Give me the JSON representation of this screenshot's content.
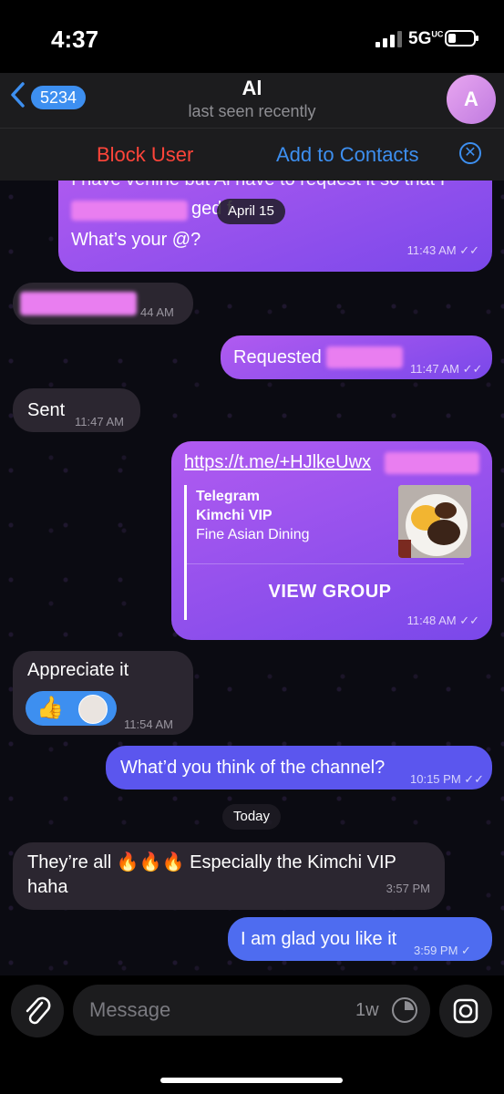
{
  "status_bar": {
    "time": "4:37",
    "network": "5G",
    "network_sup": "UC"
  },
  "header": {
    "back_count": "5234",
    "title": "Al",
    "subtitle": "last seen recently",
    "avatar_letter": "A"
  },
  "actions": {
    "block": "Block User",
    "add_contacts": "Add to Contacts"
  },
  "messages": {
    "m1": {
      "partial_top": "I have verline but Al have to request it so that I",
      "partial_mid": "ged f",
      "text": "What’s your @?",
      "time": "11:43 AM",
      "date_pill": "April 15"
    },
    "m2": {
      "time": "44 AM"
    },
    "m3": {
      "text": "Requested",
      "time": "11:47 AM"
    },
    "m4": {
      "text": "Sent",
      "time": "11:47 AM"
    },
    "m5": {
      "url": "https://t.me/+HJlkeUwx",
      "site": "Telegram",
      "name": "Kimchi VIP",
      "desc": "Fine Asian Dining",
      "button": "VIEW GROUP",
      "time": "11:48 AM"
    },
    "m6": {
      "text": "Appreciate it",
      "time": "11:54 AM"
    },
    "m7": {
      "text": "What’d you think of the channel?",
      "time": "10:15 PM"
    },
    "today_pill": "Today",
    "m8": {
      "text_a": "They’re all",
      "text_b": "Especially the Kimchi VIP",
      "text_c": "haha",
      "time": "3:57 PM"
    },
    "m9": {
      "text": "I am glad you like it",
      "time": "3:59 PM"
    }
  },
  "composer": {
    "placeholder": "Message",
    "timer_label": "1w"
  },
  "colors": {
    "accent": "#3d8ff0",
    "danger": "#ff453a",
    "outgoing": "#8b4ff0",
    "incoming": "#2b2630"
  }
}
